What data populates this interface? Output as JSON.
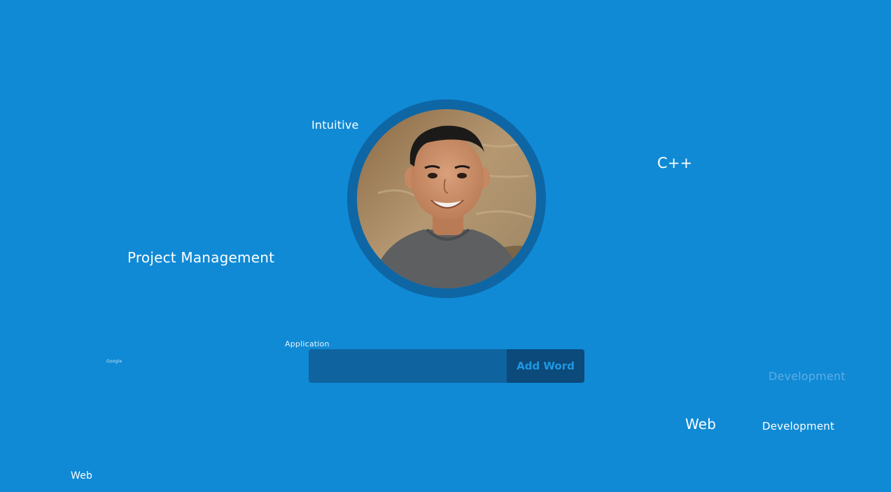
{
  "words": {
    "intuitive": "Intuitive",
    "cpp": "C++",
    "project_management": "Project Management",
    "application": "Application",
    "tiny": "Google",
    "development_faint": "Development",
    "web_large": "Web",
    "development": "Development",
    "web_small": "Web"
  },
  "form": {
    "input_value": "",
    "input_placeholder": "",
    "add_button_label": "Add Word"
  },
  "colors": {
    "background": "#118AD5",
    "ring": "#0E66A5",
    "input_bg": "#0F649F",
    "button_bg": "#0B4A7A",
    "button_text": "#1F97E3"
  }
}
